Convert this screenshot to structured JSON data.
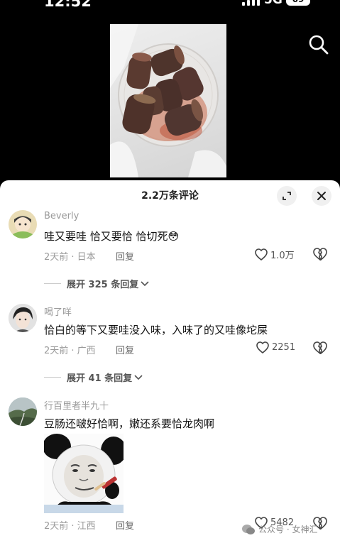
{
  "status_bar": {
    "time": "12:52",
    "network": "5G",
    "battery": "69"
  },
  "video": {
    "search_icon": "search-icon",
    "image_subject": "food-container"
  },
  "comments_panel": {
    "title": "2.2万条评论",
    "comments": [
      {
        "username": "Beverly",
        "text": "哇又要哇 恰又要恰 恰切死😳",
        "time_location": "2天前 · 日本",
        "reply_label": "回复",
        "likes": "1.0万",
        "expand_replies": "展开 325 条回复"
      },
      {
        "username": "喝了咩",
        "text": "恰白的等下又要哇没入味，入味了的又哇像坨屎",
        "time_location": "2天前 · 广西",
        "reply_label": "回复",
        "likes": "2251",
        "expand_replies": "展开 41 条回复"
      },
      {
        "username": "行百里者半九十",
        "text": "豆肠还啵好恰啊，嫩还系要恰龙肉啊",
        "time_location": "2天前 · 江西",
        "reply_label": "回复",
        "likes": "5482"
      }
    ]
  },
  "watermark": {
    "text": "公众号 · 女神汇"
  }
}
